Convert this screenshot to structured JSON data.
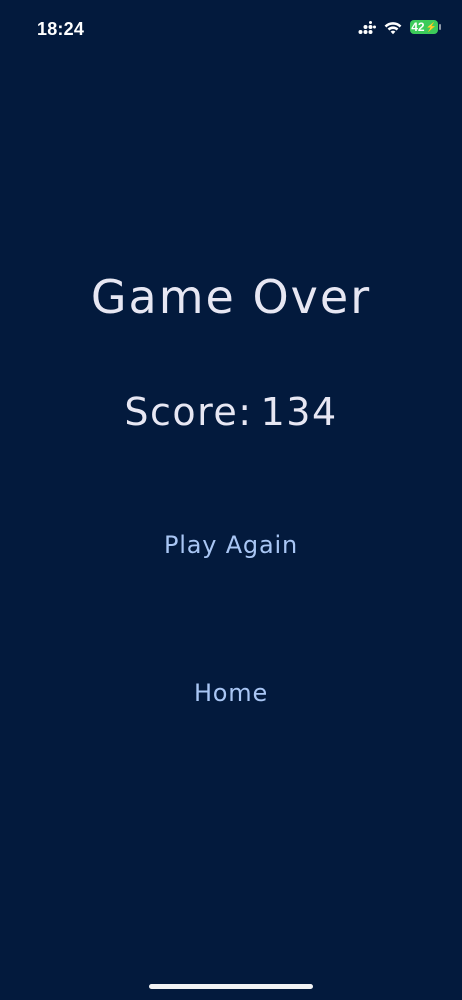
{
  "status_bar": {
    "time": "18:24",
    "signal_icon": "cellular-signal-icon",
    "wifi_icon": "wifi-icon",
    "battery_level": "42",
    "battery_icon": "battery-charging-icon"
  },
  "game_over": {
    "title": "Game Over",
    "score_label": "Score:",
    "score_value": "134"
  },
  "buttons": {
    "play_again_label": "Play Again",
    "home_label": "Home"
  },
  "colors": {
    "background": "#031a3d",
    "title_text": "#e7e7f3",
    "button_text": "#a9c6f4",
    "battery_fill": "#3ccb5a"
  }
}
